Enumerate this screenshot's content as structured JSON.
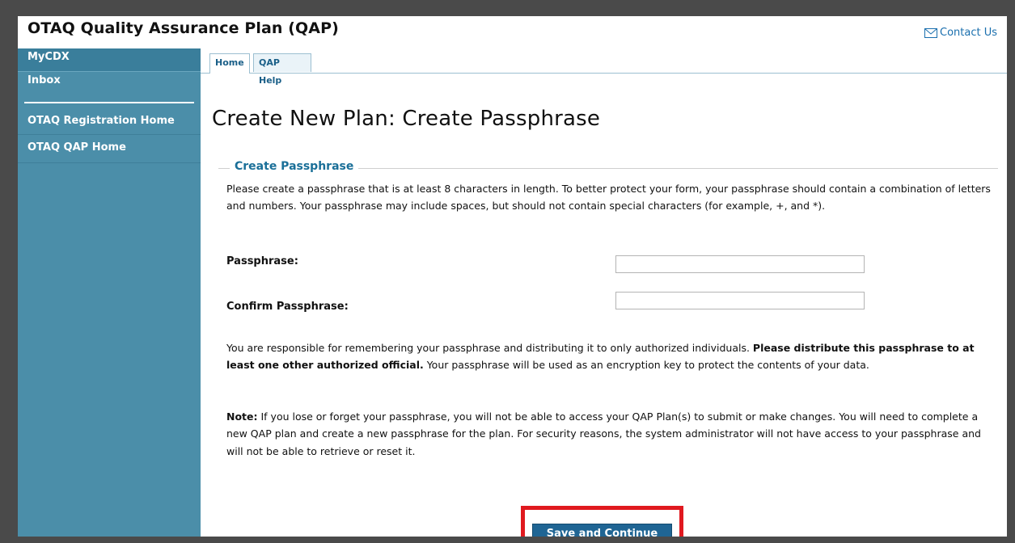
{
  "app": {
    "title": "OTAQ Quality Assurance Plan (QAP)"
  },
  "header": {
    "contact_label": "Contact Us",
    "contact_icon": "mail-icon"
  },
  "sidebar": {
    "items": [
      {
        "label": "MyCDX"
      },
      {
        "label": "Inbox"
      },
      {
        "label": "OTAQ Registration Home"
      },
      {
        "label": "OTAQ QAP Home"
      }
    ]
  },
  "tabs": [
    {
      "label": "Home",
      "active": true
    },
    {
      "label": "QAP Help",
      "active": false
    }
  ],
  "page": {
    "title": "Create New Plan: Create Passphrase"
  },
  "form": {
    "legend": "Create Passphrase",
    "intro": "Please create a passphrase that is at least 8 characters in length. To better protect your form, your passphrase should contain a combination of letters and numbers. Your passphrase may include spaces, but should not contain special characters (for example, +, and *).",
    "passphrase_label": "Passphrase:",
    "passphrase_value": "",
    "confirm_label": "Confirm Passphrase:",
    "confirm_value": "",
    "responsibility_pre": "You are responsible for remembering your passphrase and distributing it to only authorized individuals. ",
    "responsibility_bold": "Please distribute this passphrase to at least one other authorized official.",
    "responsibility_post": " Your passphrase will be used as an encryption key to protect the contents of your data.",
    "note_label": "Note:",
    "note_text": " If you lose or forget your passphrase, you will not be able to access your QAP Plan(s) to submit or make changes. You will need to complete a new QAP plan and create a new passphrase for the plan. For security reasons, the system administrator will not have access to your passphrase and will not be able to retrieve or reset it.",
    "save_label": "Save and Continue"
  },
  "colors": {
    "sidebar_bg": "#4b8ea9",
    "legend": "#1a6f98",
    "button_bg": "#1f6594",
    "highlight": "#e0191f"
  }
}
